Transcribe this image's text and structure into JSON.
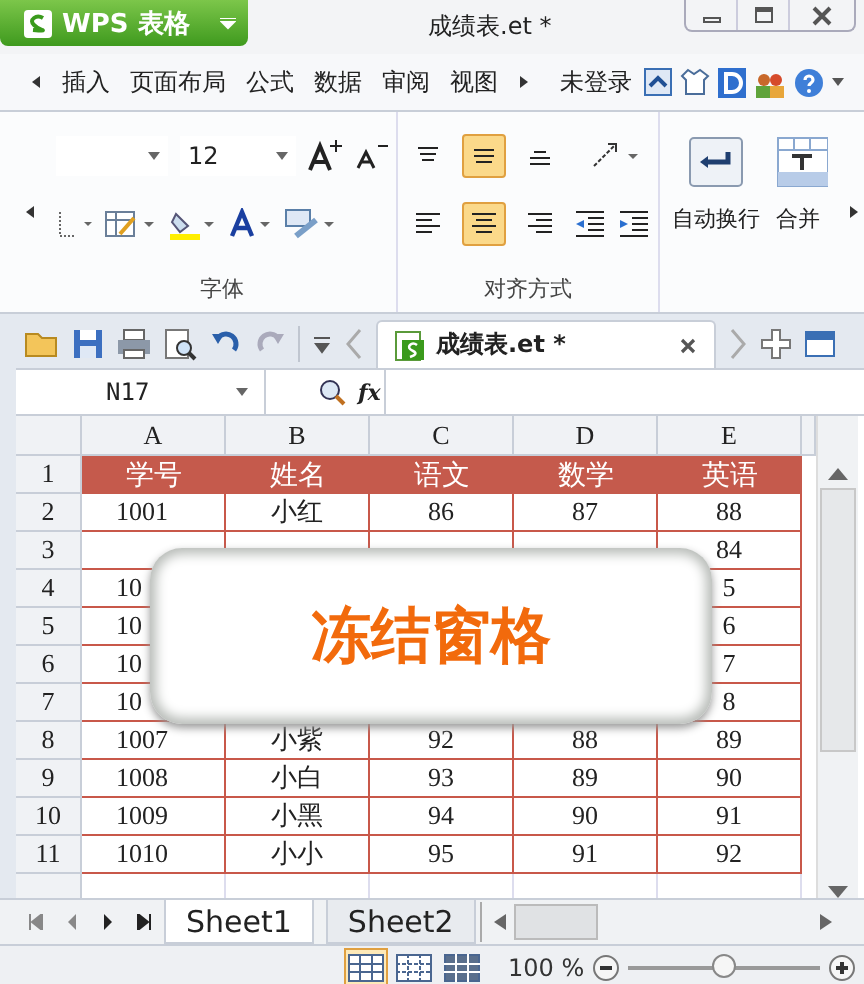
{
  "app_button": {
    "label": "WPS 表格"
  },
  "window": {
    "title": "成绩表.et *"
  },
  "ribbon_tabs": [
    {
      "label": "插入",
      "selected": false
    },
    {
      "label": "页面布局",
      "selected": false
    },
    {
      "label": "公式",
      "selected": false
    },
    {
      "label": "数据",
      "selected": false
    },
    {
      "label": "审阅",
      "selected": false
    },
    {
      "label": "视图",
      "selected": false
    }
  ],
  "account": {
    "label": "未登录"
  },
  "ribbon": {
    "font_size": "12",
    "wrap_text": "自动换行",
    "merge": "合并",
    "groups": [
      "字体",
      "对齐方式"
    ],
    "vertical_align": [
      {
        "selected": false
      },
      {
        "selected": true
      },
      {
        "selected": false
      }
    ],
    "horizontal_align": [
      {
        "selected": false
      },
      {
        "selected": true
      },
      {
        "selected": false
      }
    ]
  },
  "document_tab": {
    "label": "成绩表.et *"
  },
  "formula_bar": {
    "cell_reference": "N17",
    "function_label": "fx"
  },
  "sheet": {
    "columns": [
      "A",
      "B",
      "C",
      "D",
      "E"
    ],
    "rows": [
      {
        "number": "1",
        "kind": "header",
        "cells": [
          "学号",
          "姓名",
          "语文",
          "数学",
          "英语"
        ]
      },
      {
        "number": "2",
        "kind": "data",
        "cells": [
          "1001",
          "小红",
          "86",
          "87",
          "88"
        ]
      },
      {
        "number": "3",
        "kind": "data",
        "cells": [
          null,
          null,
          null,
          null,
          "84"
        ]
      },
      {
        "number": "4",
        "kind": "data",
        "cells": [
          "10",
          null,
          null,
          null,
          "5"
        ]
      },
      {
        "number": "5",
        "kind": "data",
        "cells": [
          "10",
          null,
          null,
          null,
          "6"
        ]
      },
      {
        "number": "6",
        "kind": "data",
        "cells": [
          "10",
          null,
          null,
          null,
          "7"
        ]
      },
      {
        "number": "7",
        "kind": "data",
        "cells": [
          "10",
          null,
          null,
          null,
          "8"
        ]
      },
      {
        "number": "8",
        "kind": "data",
        "cells": [
          "1007",
          "小紫",
          "92",
          "88",
          "89"
        ]
      },
      {
        "number": "9",
        "kind": "data",
        "cells": [
          "1008",
          "小白",
          "93",
          "89",
          "90"
        ]
      },
      {
        "number": "10",
        "kind": "data",
        "cells": [
          "1009",
          "小黑",
          "94",
          "90",
          "91"
        ]
      },
      {
        "number": "11",
        "kind": "data",
        "cells": [
          "1010",
          "小小",
          "95",
          "91",
          "92"
        ]
      }
    ]
  },
  "overlay": {
    "text": "冻结窗格"
  },
  "sheet_tabs": [
    {
      "label": "Sheet1",
      "selected": true
    },
    {
      "label": "Sheet2",
      "selected": false
    }
  ],
  "status_bar": {
    "views": [
      {
        "selected": true
      },
      {
        "selected": false
      },
      {
        "selected": false
      }
    ],
    "zoom": "100 %",
    "zoom_slider": {
      "level": 0.5
    }
  }
}
